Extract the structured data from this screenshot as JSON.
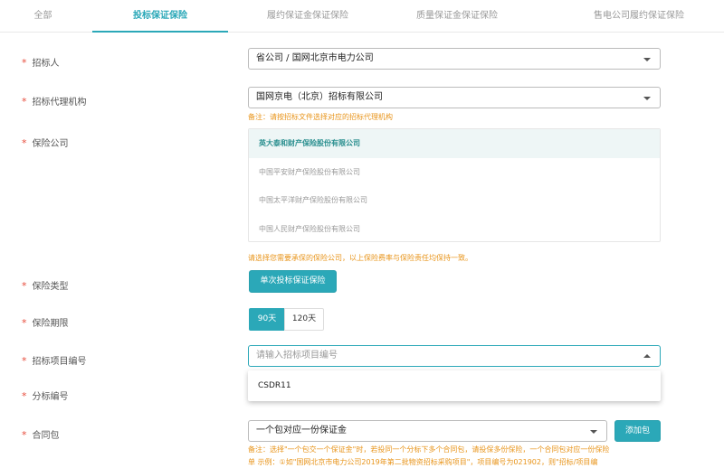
{
  "tabs": [
    {
      "label": "全部"
    },
    {
      "label": "投标保证保险"
    },
    {
      "label": "履约保证金保证保险"
    },
    {
      "label": "质量保证金保证保险"
    },
    {
      "label": "售电公司履约保证保险"
    }
  ],
  "form": {
    "bidder": {
      "label": "招标人",
      "value": "省公司 / 国网北京市电力公司"
    },
    "agency": {
      "label": "招标代理机构",
      "value": "国网京电（北京）招标有限公司",
      "note": "备注：请按招标文件选择对应的招标代理机构"
    },
    "insurer": {
      "label": "保险公司",
      "options": [
        "英大泰和财产保险股份有限公司",
        "中国平安财产保险股份有限公司",
        "中国太平洋财产保险股份有限公司",
        "中国人民财产保险股份有限公司"
      ],
      "note": "请选择您需要承保的保险公司，以上保险费率与保险责任均保持一致。"
    },
    "ins_type": {
      "label": "保险类型",
      "button": "单次投标保证保险"
    },
    "period": {
      "label": "保险期限",
      "on": "90天",
      "off": "120天"
    },
    "project_no": {
      "label": "招标项目编号",
      "placeholder": "请输入招标项目编号",
      "dropdown_option": "CSDR11"
    },
    "section_no": {
      "label": "分标编号"
    },
    "contract": {
      "label": "合同包",
      "value": "一个包对应一份保证金",
      "add_button": "添加包",
      "note_line1": "备注：选择\"一个包交一个保证金\"时，若投同一个分标下多个合同包，请投保多份保险，一个合同包对应一份保险",
      "note_line2": "单 示例：①如\"国网北京市电力公司2019年第二批物资招标采购项目\"，项目编号为021902，则\"招标/项目编"
    }
  }
}
